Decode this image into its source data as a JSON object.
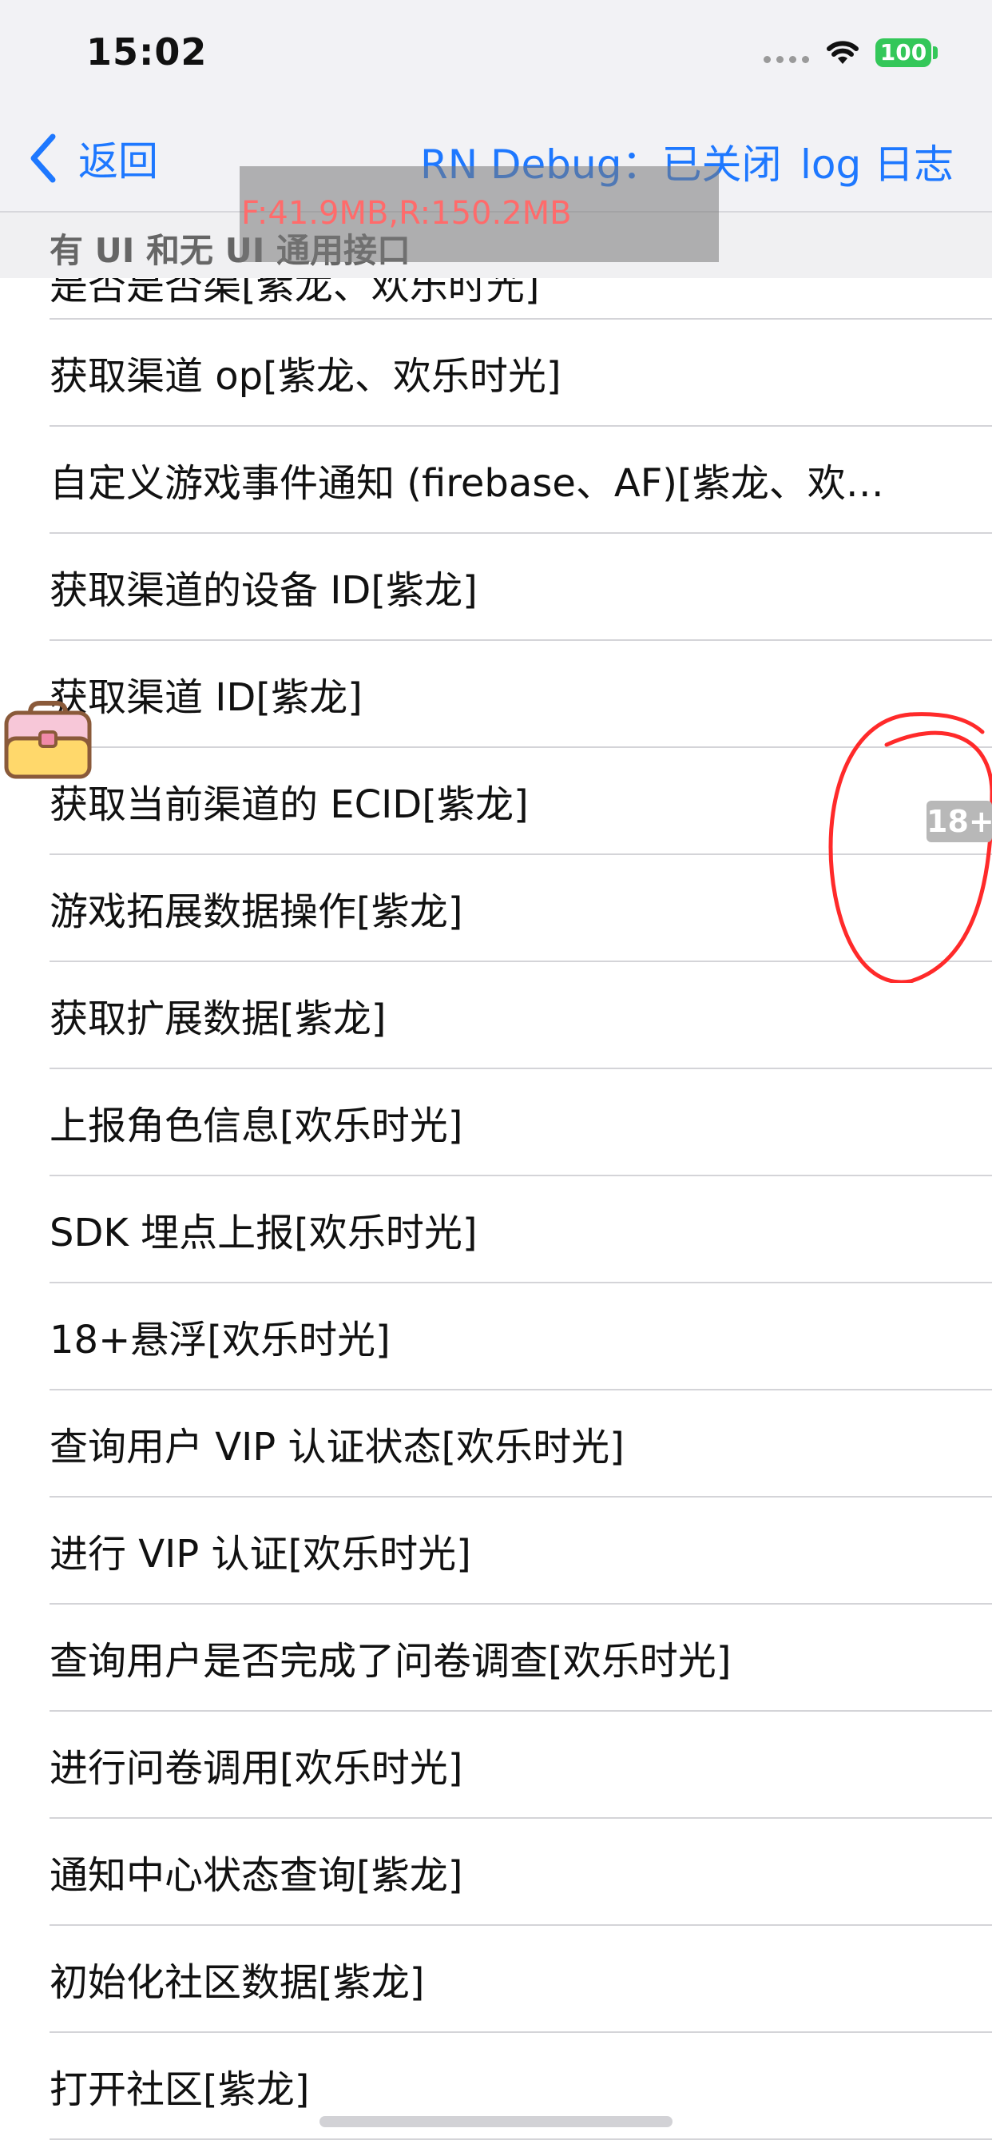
{
  "status_bar": {
    "time": "15:02",
    "battery": "100",
    "wifi_icon": "wifi-icon",
    "signal_icon": "signal-dots-icon"
  },
  "nav": {
    "back_label": "返回",
    "back_icon": "chevron-left-icon",
    "rn_debug": "RN Debug：已关闭",
    "log_label": "log 日志"
  },
  "debug_overlay": {
    "text": "F:41.9MB,R:150.2MB"
  },
  "section": {
    "title": "有 UI 和无 UI 通用接口"
  },
  "list": {
    "partial_item": "是否是否渠[紫龙、欢乐时光]",
    "items": [
      "获取渠道 op[紫龙、欢乐时光]",
      "自定义游戏事件通知 (firebase、AF)[紫龙、欢乐时光]",
      "获取渠道的设备 ID[紫龙]",
      "获取渠道 ID[紫龙]",
      "获取当前渠道的 ECID[紫龙]",
      "游戏拓展数据操作[紫龙]",
      "获取扩展数据[紫龙]",
      "上报角色信息[欢乐时光]",
      "SDK 埋点上报[欢乐时光]",
      "18+悬浮[欢乐时光]",
      "查询用户 VIP 认证状态[欢乐时光]",
      "进行 VIP 认证[欢乐时光]",
      "查询用户是否完成了问卷调查[欢乐时光]",
      "进行问卷调用[欢乐时光]",
      "通知中心状态查询[紫龙]",
      "初始化社区数据[紫龙]",
      "打开社区[紫龙]"
    ]
  },
  "floating": {
    "age_badge": "18+",
    "toolbox_icon": "toolbox-icon",
    "annotation": "red-circle-annotation"
  },
  "colors": {
    "accent": "#1e78ff",
    "battery": "#34c759",
    "annotation": "#ff2a2a",
    "debug_text": "#ff6b6b"
  }
}
